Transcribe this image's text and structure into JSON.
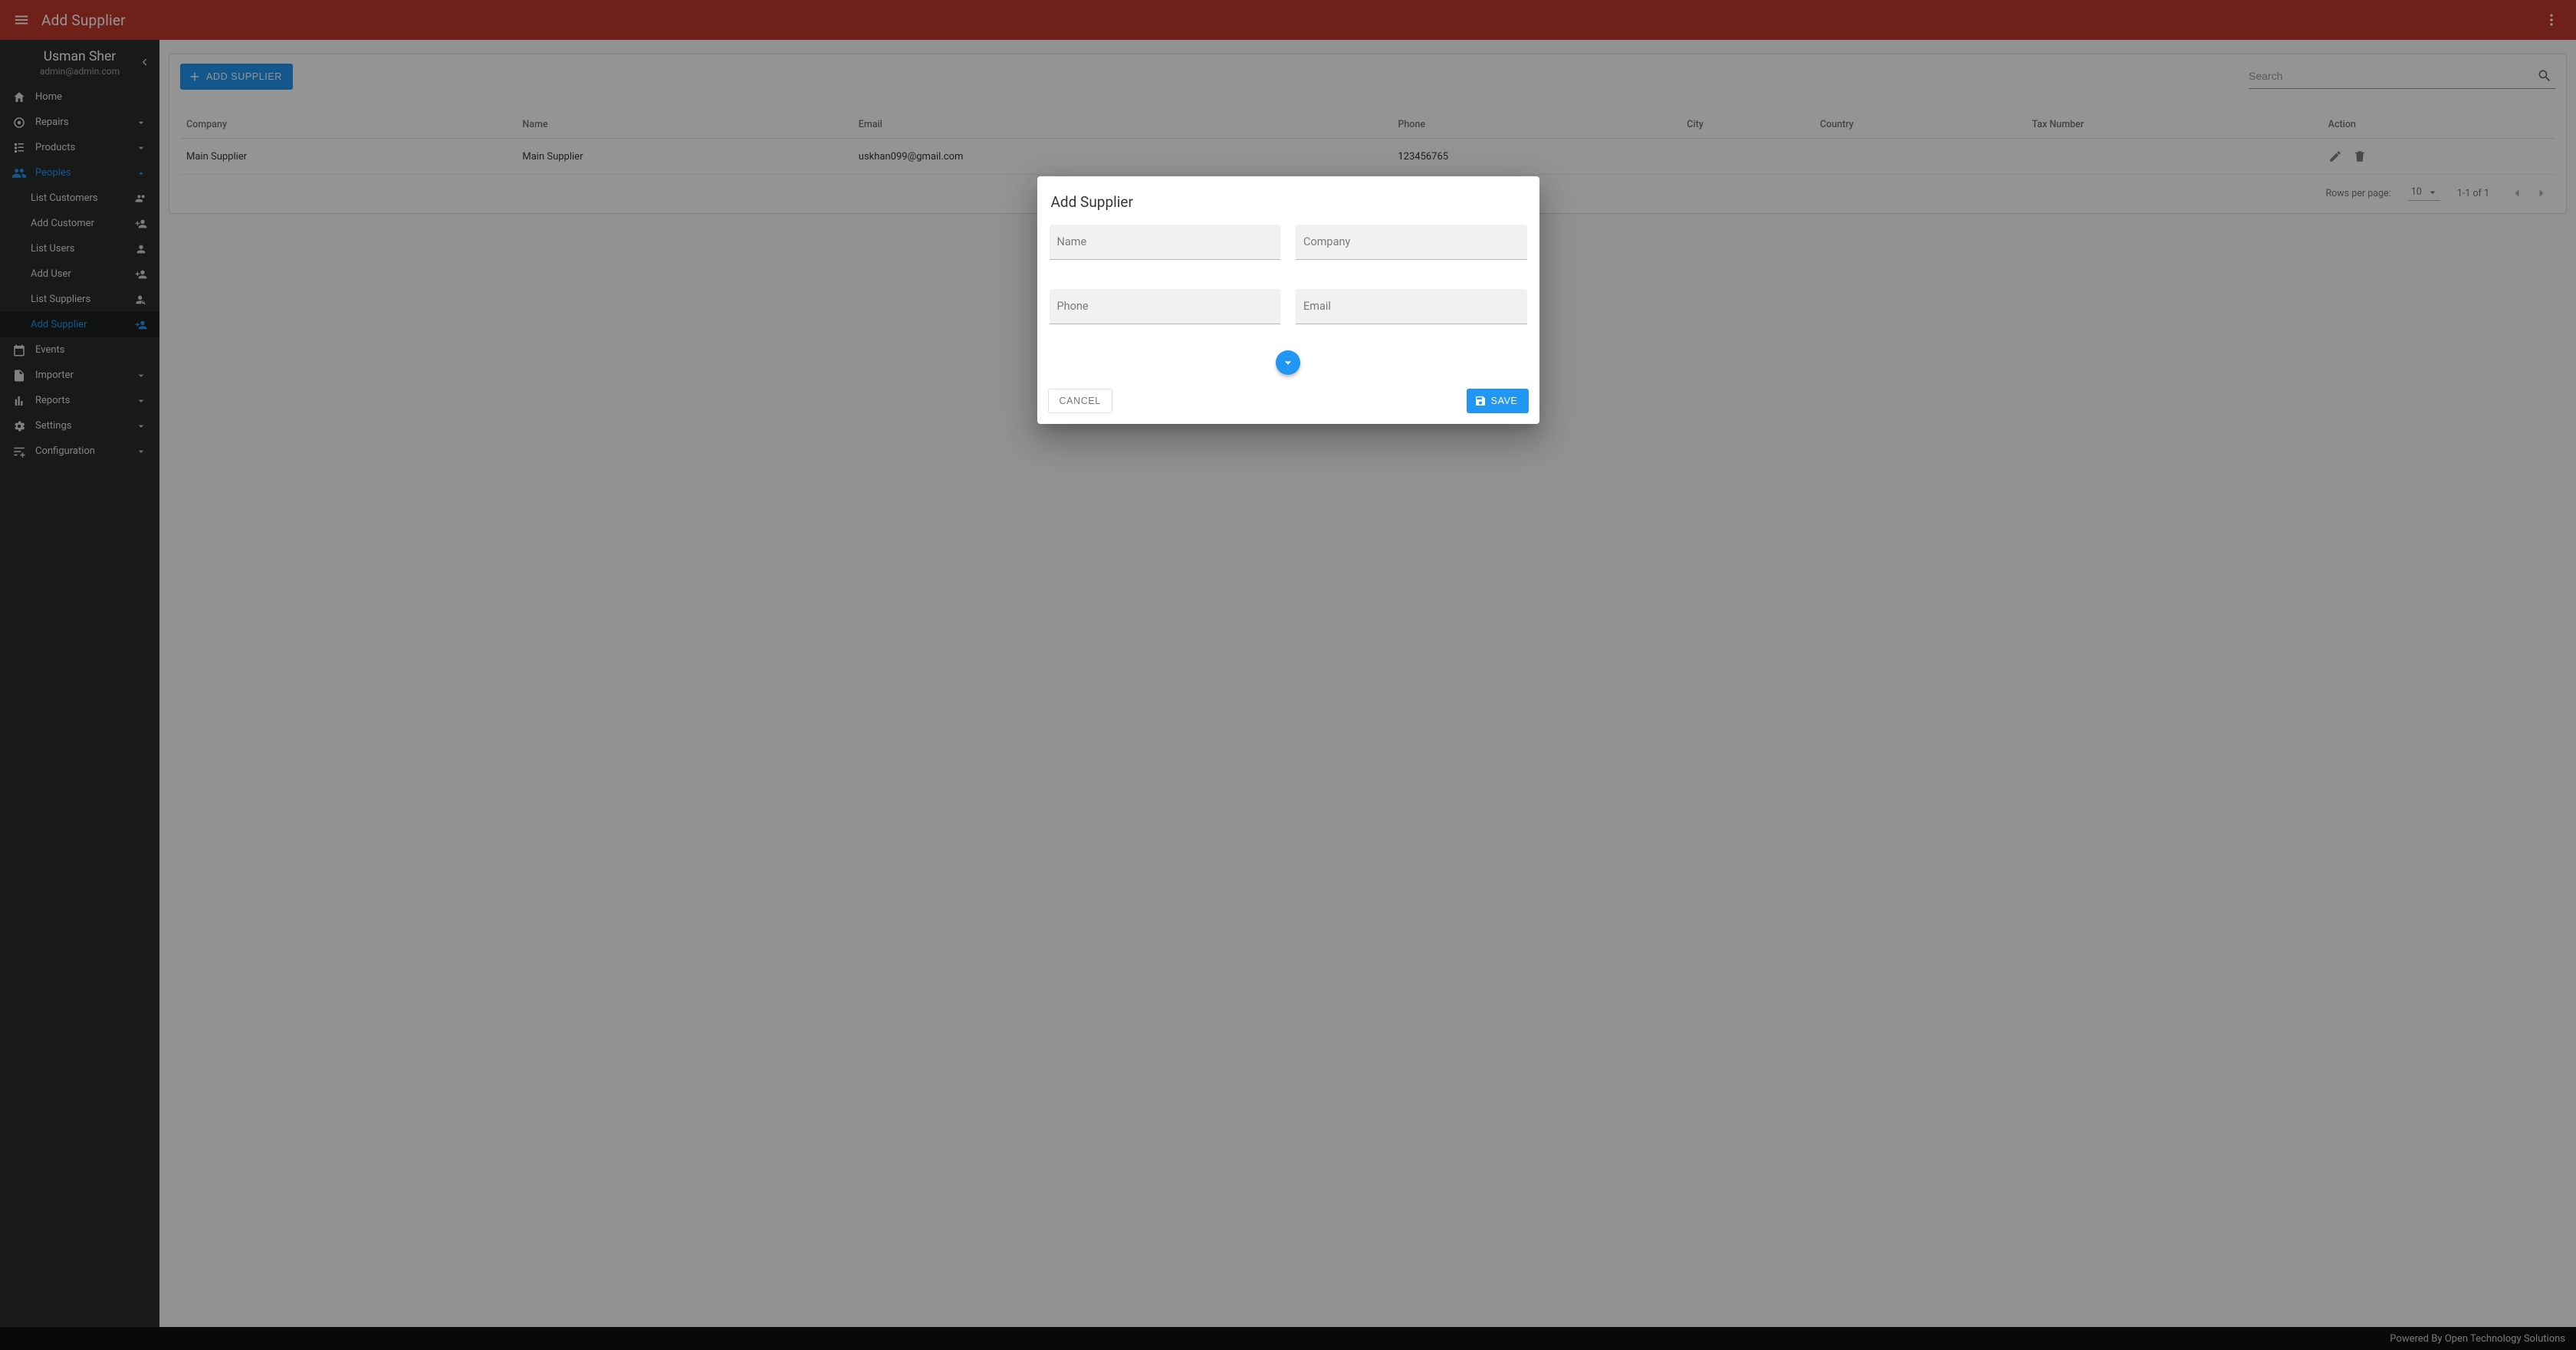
{
  "appbar": {
    "title": "Add Supplier"
  },
  "user": {
    "name": "Usman Sher",
    "email": "admin@admin.com"
  },
  "sidebar": {
    "items": [
      {
        "label": "Home"
      },
      {
        "label": "Repairs"
      },
      {
        "label": "Products"
      },
      {
        "label": "Peoples"
      },
      {
        "label": "Events"
      },
      {
        "label": "Importer"
      },
      {
        "label": "Reports"
      },
      {
        "label": "Settings"
      },
      {
        "label": "Configuration"
      }
    ],
    "peoples_sub": [
      {
        "label": "List Customers"
      },
      {
        "label": "Add Customer"
      },
      {
        "label": "List Users"
      },
      {
        "label": "Add User"
      },
      {
        "label": "List Suppliers"
      },
      {
        "label": "Add Supplier"
      }
    ]
  },
  "toolbar": {
    "add_label": "Add Supplier",
    "search_placeholder": "Search"
  },
  "table": {
    "columns": [
      "Company",
      "Name",
      "Email",
      "Phone",
      "City",
      "Country",
      "Tax Number",
      "Action"
    ],
    "rows": [
      {
        "company": "Main Supplier",
        "name": "Main Supplier",
        "email": "uskhan099@gmail.com",
        "phone": "123456765",
        "city": "",
        "country": "",
        "tax": ""
      }
    ],
    "footer": {
      "rpp_label": "Rows per page:",
      "rpp_value": "10",
      "range": "1-1 of 1"
    }
  },
  "dialog": {
    "title": "Add Supplier",
    "fields": {
      "name": "Name",
      "company": "Company",
      "phone": "Phone",
      "email": "Email"
    },
    "cancel": "Cancel",
    "save": "Save"
  },
  "footer_text": "Powered By Open Technology Solutions"
}
